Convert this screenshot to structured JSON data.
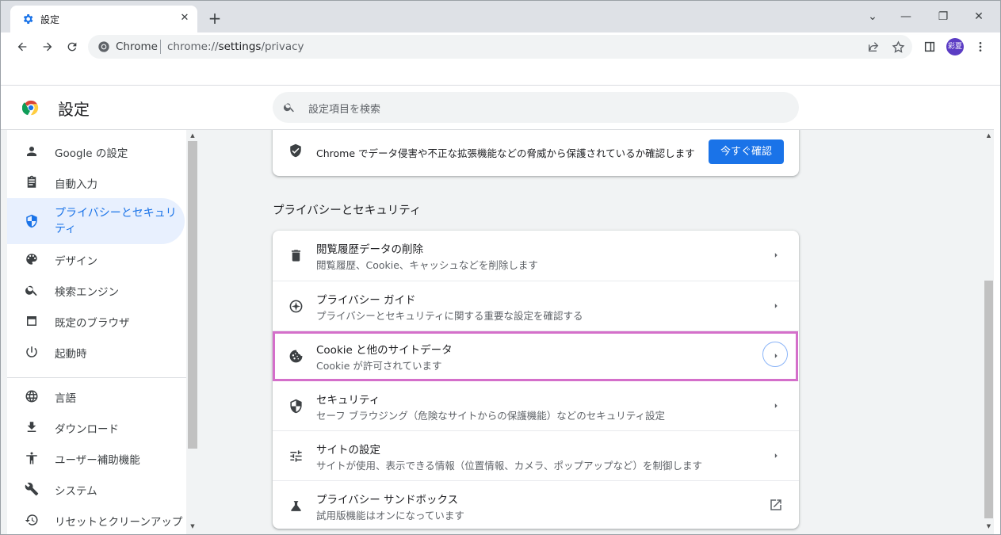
{
  "browser": {
    "tab_title": "設定",
    "tab_close": "✕",
    "new_tab": "+",
    "site_label": "Chrome",
    "url_prefix": "chrome://",
    "url_host": "settings",
    "url_path": "/privacy",
    "avatar_text": "彩夏",
    "window_controls": [
      "⌄",
      "—",
      "❐",
      "✕"
    ]
  },
  "header": {
    "title": "設定",
    "search_placeholder": "設定項目を検索"
  },
  "sidebar": {
    "items": [
      {
        "icon": "person-icon",
        "label": "Google の設定"
      },
      {
        "icon": "assignment-icon",
        "label": "自動入力"
      },
      {
        "icon": "shield-icon",
        "label": "プライバシーとセキュリティ",
        "active": true
      },
      {
        "icon": "palette-icon",
        "label": "デザイン"
      },
      {
        "icon": "search-icon",
        "label": "検索エンジン"
      },
      {
        "icon": "browser-icon",
        "label": "既定のブラウザ"
      },
      {
        "icon": "power-icon",
        "label": "起動時"
      },
      {
        "icon": "globe-icon",
        "label": "言語"
      },
      {
        "icon": "download-icon",
        "label": "ダウンロード"
      },
      {
        "icon": "accessibility-icon",
        "label": "ユーザー補助機能"
      },
      {
        "icon": "wrench-icon",
        "label": "システム"
      },
      {
        "icon": "restore-icon",
        "label": "リセットとクリーンアップ"
      }
    ]
  },
  "safety_check": {
    "text": "Chrome でデータ侵害や不正な拡張機能などの脅威から保護されているか確認します",
    "button": "今すぐ確認"
  },
  "section_title": "プライバシーとセキュリティ",
  "rows": [
    {
      "icon": "trash-icon",
      "title": "閲覧履歴データの削除",
      "subtitle": "閲覧履歴、Cookie、キャッシュなどを削除します"
    },
    {
      "icon": "compass-icon",
      "title": "プライバシー ガイド",
      "subtitle": "プライバシーとセキュリティに関する重要な設定を確認する"
    },
    {
      "icon": "cookie-icon",
      "title": "Cookie と他のサイトデータ",
      "subtitle": "Cookie が許可されています"
    },
    {
      "icon": "security-shield-icon",
      "title": "セキュリティ",
      "subtitle": "セーフ ブラウジング（危険なサイトからの保護機能）などのセキュリティ設定"
    },
    {
      "icon": "tune-icon",
      "title": "サイトの設定",
      "subtitle": "サイトが使用、表示できる情報（位置情報、カメラ、ポップアップなど）を制御します"
    },
    {
      "icon": "flask-icon",
      "title": "プライバシー サンドボックス",
      "subtitle": "試用版機能はオンになっています"
    }
  ],
  "colors": {
    "accent": "#1a73e8",
    "highlight": "#d46fca",
    "active_bg": "#e8f0fe"
  }
}
